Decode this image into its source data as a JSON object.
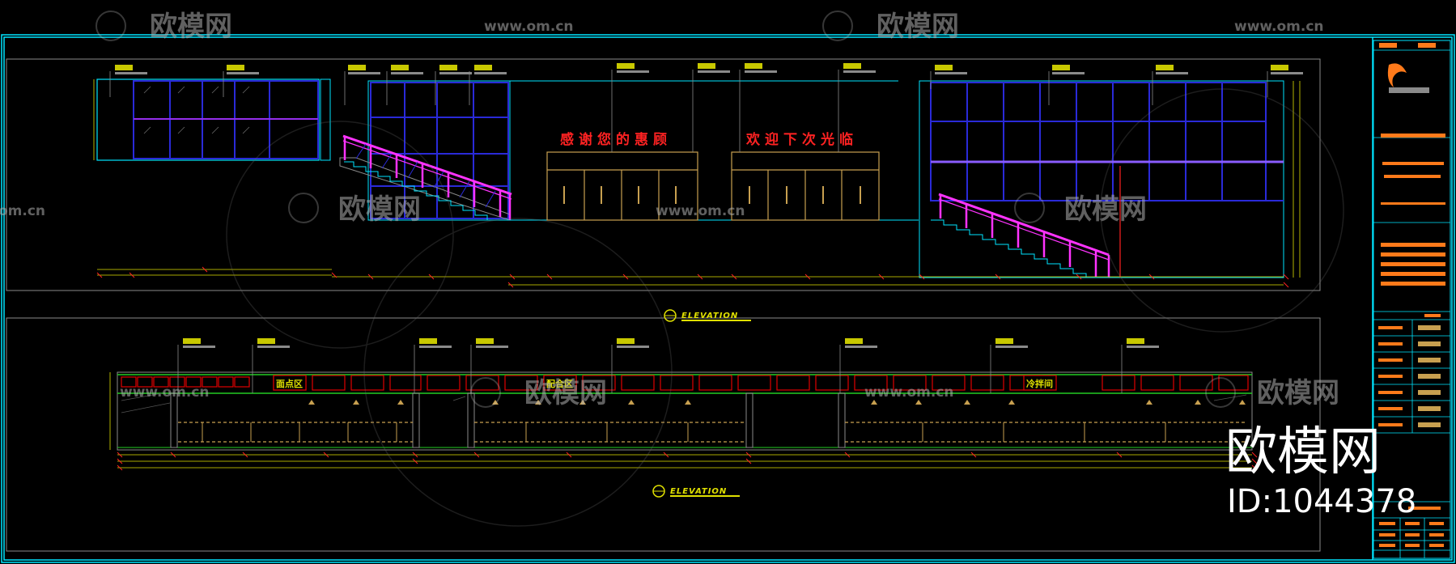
{
  "colors": {
    "background": "#000000",
    "frame": "#00e5ff",
    "glass_frame": "#2a2ad8",
    "rail": "#ff33ff",
    "door": "#c8a050",
    "slogan": "#ff2222",
    "tag_bg": "#c8c800",
    "dim": "#e0e000",
    "zone_box": "#e00000",
    "green": "#22cc22",
    "titleblock_accent": "#ff7a1a"
  },
  "watermark": {
    "brand": "欧模网",
    "site": "www.om.cn",
    "site_short": "om.cn",
    "brand_large": "欧模网",
    "id_label": "ID:1044378"
  },
  "elevation_1": {
    "slogan_left": "感谢您的惠顾",
    "slogan_right": "欢迎下次光临",
    "title": "ELEVATION"
  },
  "elevation_2": {
    "zones": [
      "面点区",
      "配合区",
      "冷拌间"
    ],
    "title": "ELEVATION"
  }
}
